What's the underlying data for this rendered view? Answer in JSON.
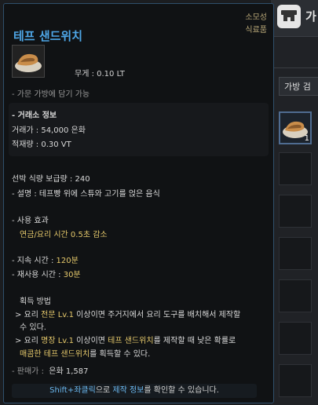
{
  "tooltip": {
    "category1": "소모성",
    "category2": "식료품",
    "title": "테프 샌드위치",
    "weight": "무게 :  0.10 LT",
    "bag_note": "- 가문 가방에 담기 가능",
    "market_header": "- 거래소 정보",
    "market_price": "거래가 : 54,000 은화",
    "market_weight": "적재량 : 0.30 VT",
    "ship_food": "선박 식량 보급량 : 240",
    "desc": "- 설명 : 테프빵 위에 스튜와 고기를 얹은 음식",
    "effect_header": "- 사용 효과",
    "effect_value": "연금/요리 시간 0.5초 감소",
    "duration_prefix": "- 지속 시간 : ",
    "duration_value": "120분",
    "cooldown_prefix": "- 재사용 시간 : ",
    "cooldown_value": "30분",
    "obtain_header": "획득 방법",
    "obtain1_prefix": "> 요리 ",
    "obtain1_hl": "전문 Lv.1",
    "obtain1_rest": " 이상이면 주거지에서 요리 도구를 배치해서 제작할",
    "obtain1_line2": "수 있다.",
    "obtain2_prefix": "> 요리 ",
    "obtain2_hl": "명장 Lv.1",
    "obtain2_mid": " 이상이면 ",
    "obtain2_hl2": "테프 샌드위치",
    "obtain2_rest": "를 제작할 때 낮은 확률로",
    "obtain2_line2_hl": "매콤한 테프 샌드위치",
    "obtain2_line2_rest": "를 획득할 수 있다.",
    "sell_price_label": "- 판매가 :",
    "sell_price_value": "은화 1,587",
    "bottom_hint_hl": "Shift+좌클릭",
    "bottom_hint_mid": "으로 ",
    "bottom_hint_hl2": "제작 정보",
    "bottom_hint_rest": "를 확인할 수 있습니다."
  },
  "bg": {
    "window_title": "가",
    "bag_tab": "가방 검",
    "slot_count": "1"
  },
  "colors": {
    "title": "#4ea6e6",
    "highlight": "#e6c96b",
    "border": "#2f4f6b"
  }
}
